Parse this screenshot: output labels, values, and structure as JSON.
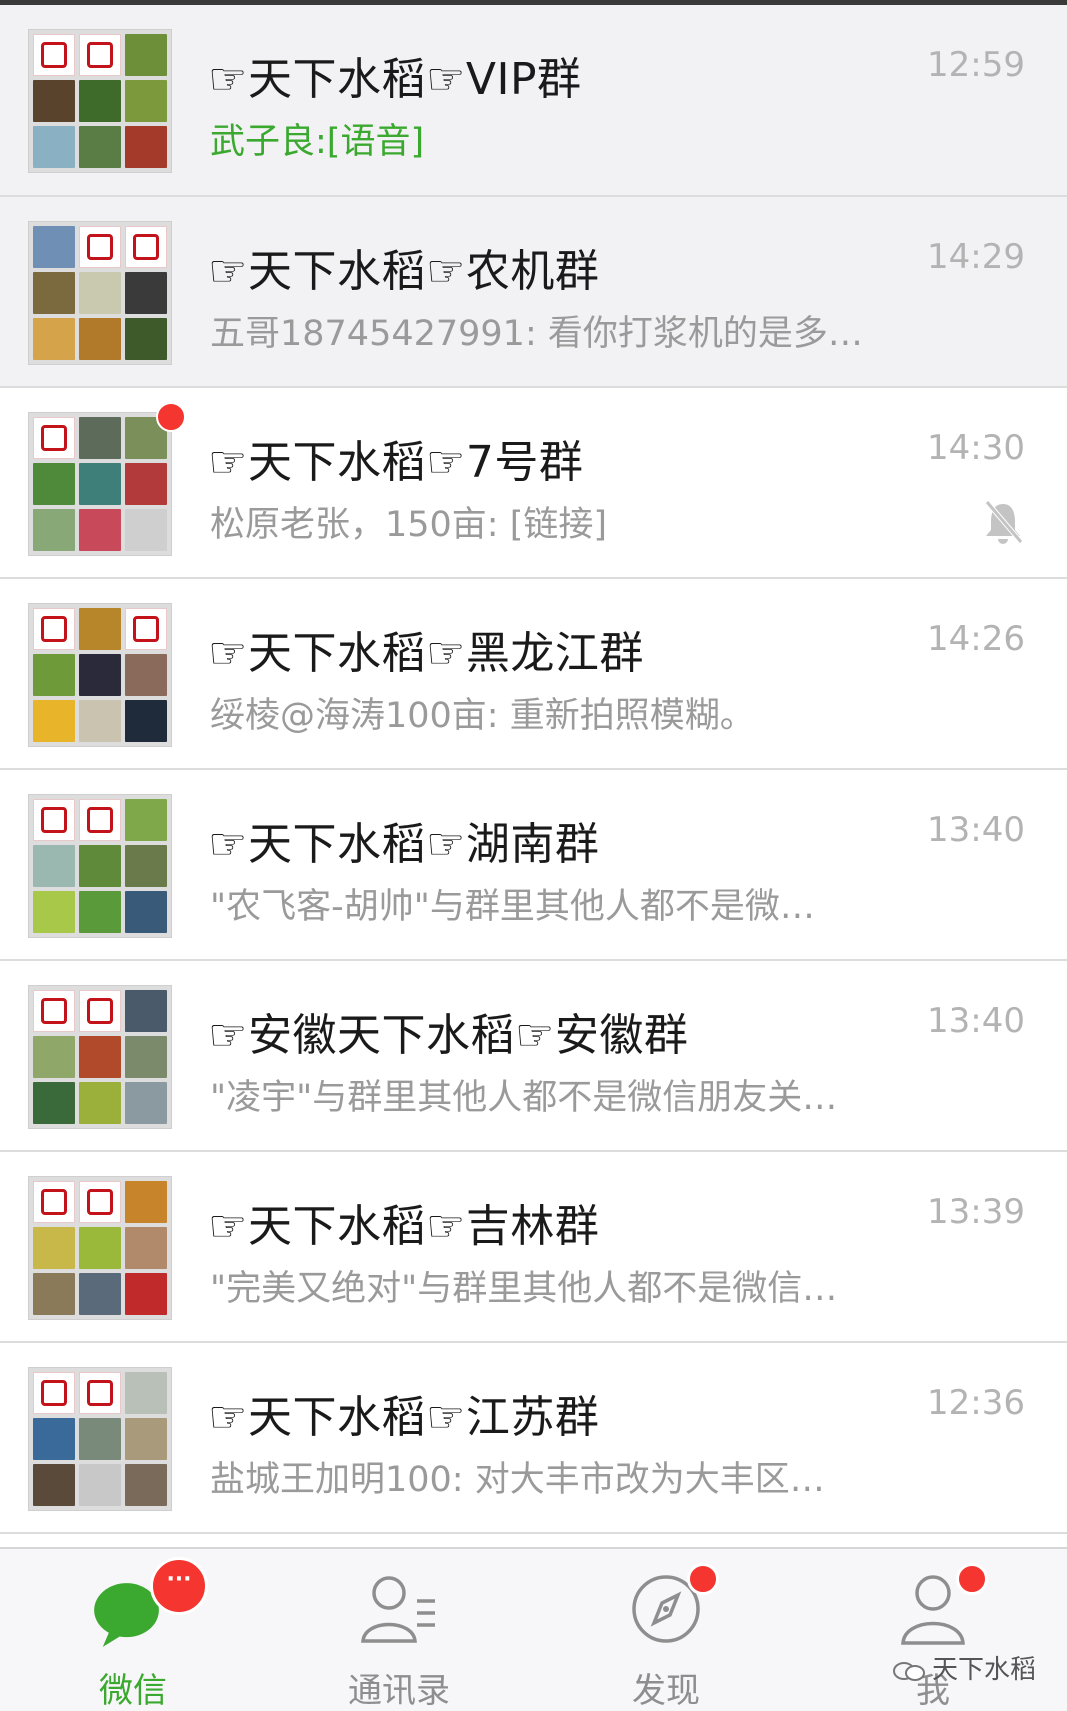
{
  "chats": [
    {
      "title": "☞天下水稻☞VIP群",
      "preview": "武子良:[语音]",
      "preview_highlight": true,
      "time": "12:59",
      "pinned": true,
      "unread": false,
      "muted": false
    },
    {
      "title": "☞天下水稻☞农机群",
      "preview": "五哥18745427991: 看你打浆机的是多…",
      "preview_highlight": false,
      "time": "14:29",
      "pinned": true,
      "unread": false,
      "muted": false
    },
    {
      "title": "☞天下水稻☞7号群",
      "preview": "松原老张，150亩: [链接]",
      "preview_highlight": false,
      "time": "14:30",
      "pinned": false,
      "unread": true,
      "muted": true
    },
    {
      "title": "☞天下水稻☞黑龙江群",
      "preview": "绥棱@海涛100亩: 重新拍照模糊。",
      "preview_highlight": false,
      "time": "14:26",
      "pinned": false,
      "unread": false,
      "muted": false
    },
    {
      "title": "☞天下水稻☞湖南群",
      "preview": "\"农飞客-胡帅\"与群里其他人都不是微…",
      "preview_highlight": false,
      "time": "13:40",
      "pinned": false,
      "unread": false,
      "muted": false
    },
    {
      "title": "☞安徽天下水稻☞安徽群",
      "preview": "\"凌宇\"与群里其他人都不是微信朋友关…",
      "preview_highlight": false,
      "time": "13:40",
      "pinned": false,
      "unread": false,
      "muted": false
    },
    {
      "title": "☞天下水稻☞吉林群",
      "preview": "\"完美又绝对\"与群里其他人都不是微信…",
      "preview_highlight": false,
      "time": "13:39",
      "pinned": false,
      "unread": false,
      "muted": false
    },
    {
      "title": "☞天下水稻☞江苏群",
      "preview": "盐城王加明100: 对大丰市改为大丰区…",
      "preview_highlight": false,
      "time": "12:36",
      "pinned": false,
      "unread": false,
      "muted": false
    }
  ],
  "avatar_logo_text": "天下水稻",
  "tabs": [
    {
      "label": "微信",
      "icon": "chat-bubbles-icon",
      "active": true,
      "badge": "···"
    },
    {
      "label": "通讯录",
      "icon": "contacts-icon",
      "active": false
    },
    {
      "label": "发现",
      "icon": "compass-icon",
      "active": false
    },
    {
      "label": "我",
      "icon": "person-icon",
      "active": false
    }
  ],
  "watermark": "天下水稻",
  "colors": {
    "accent_green": "#3ba92f",
    "badge_red": "#f43530",
    "pinned_bg": "#f2f2f5",
    "time_gray": "#b3b3b3",
    "preview_gray": "#9a9a9a"
  }
}
